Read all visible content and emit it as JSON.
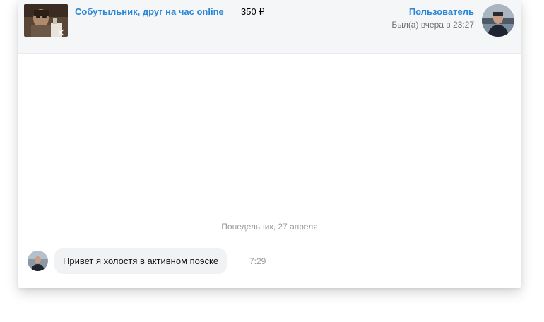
{
  "header": {
    "ad_thumbnail_icon": "ad-photo-thumbnail",
    "ad_title": "Собутыльник, друг на час online",
    "ad_price": "350 ₽",
    "user_name": "Пользователь",
    "user_status": "Был(а) вчера в 23:27",
    "user_avatar_icon": "user-avatar-photo"
  },
  "chat": {
    "date_separator": "Понедельник, 27 апреля",
    "messages": [
      {
        "text": "Привет я холостя в активном поэске",
        "time": "7:29",
        "avatar_icon": "sender-avatar-photo"
      }
    ]
  },
  "colors": {
    "link": "#2a85d6",
    "header_bg": "#f5f6f8",
    "bubble_bg": "#f1f2f4",
    "muted_text": "#9a9a9a"
  }
}
